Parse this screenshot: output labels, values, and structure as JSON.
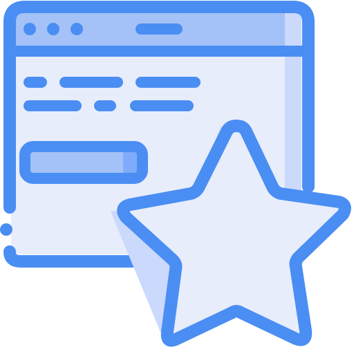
{
  "icon": {
    "name": "browser-favorite-icon",
    "parts": [
      "browser-window-icon",
      "star-icon"
    ]
  },
  "colors": {
    "outline": "#4a8ef3",
    "title_bar_fill": "#a4c2f7",
    "page_fill": "#e8edfc",
    "page_shade": "#cad9fc",
    "star_fill": "#e8edfc",
    "star_shadow": "#cad9fc",
    "button_fill": "#a4c2f7",
    "button_shade": "#7facfa",
    "background": "#ffffff"
  },
  "window": {
    "title_bar": {
      "dots": 3,
      "has_title_pill": true
    },
    "content": {
      "text_line_rows": 2,
      "has_button": true
    }
  }
}
